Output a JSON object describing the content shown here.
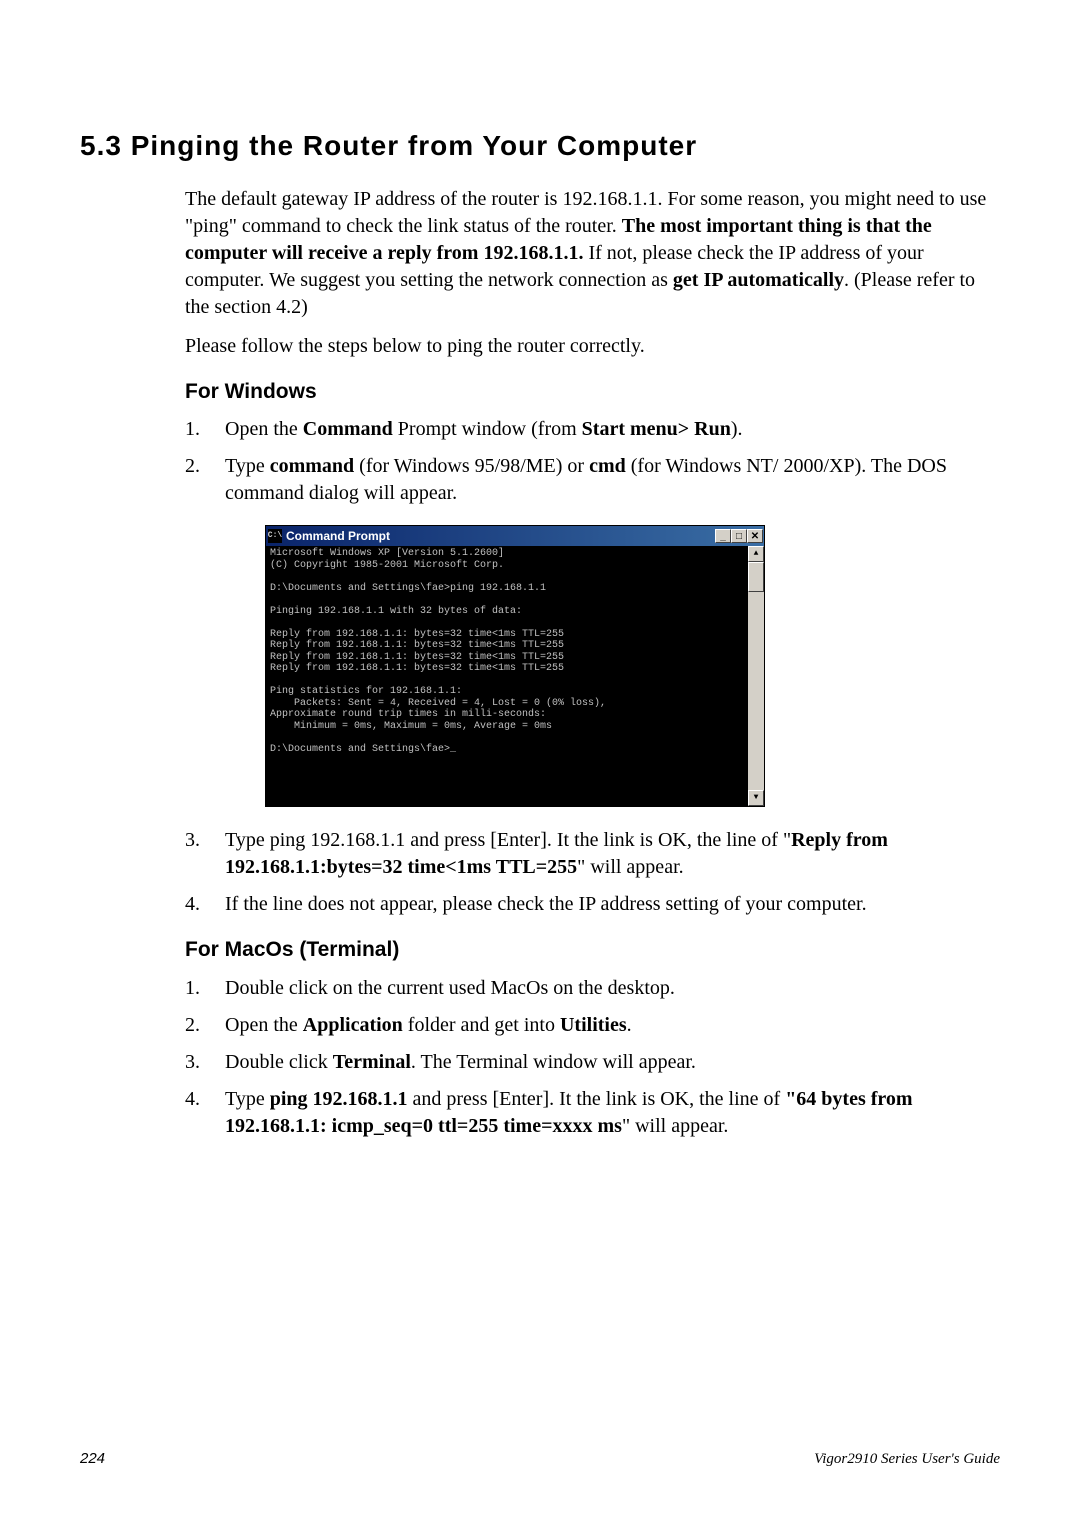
{
  "section": {
    "title": "5.3 Pinging the Router from Your Computer"
  },
  "intro": {
    "p1_a": "The default gateway IP address of the router is 192.168.1.1. For some reason, you might need to use \"ping\" command to check the link status of the router. ",
    "p1_b": "The most important thing is that the computer will receive a reply from 192.168.1.1.",
    "p1_c": " If not, please check the IP address of your computer. We suggest you setting the network connection as ",
    "p1_d": "get IP automatically",
    "p1_e": ". (Please refer to the section 4.2)",
    "p2": "Please follow the steps below to ping the router correctly."
  },
  "windows": {
    "heading": "For Windows",
    "li1_a": "Open the ",
    "li1_b": "Command",
    "li1_c": " Prompt window (from ",
    "li1_d": "Start menu> Run",
    "li1_e": ").",
    "li2_a": "Type ",
    "li2_b": "command",
    "li2_c": " (for Windows 95/98/ME) or ",
    "li2_d": "cmd",
    "li2_e": " (for Windows NT/ 2000/XP). The DOS command dialog will appear.",
    "li3_a": "Type ping 192.168.1.1 and press [Enter]. It the link is OK, the line of \"",
    "li3_b": "Reply from 192.168.1.1:bytes=32 time<1ms TTL=255",
    "li3_c": "\" will appear.",
    "li4": "If the line does not appear, please check the IP address setting of your computer."
  },
  "cmd": {
    "title": "Command Prompt",
    "icon_text": "C:\\",
    "min": "_",
    "max": "□",
    "close": "✕",
    "up": "▲",
    "down": "▼",
    "body": "Microsoft Windows XP [Version 5.1.2600]\n(C) Copyright 1985-2001 Microsoft Corp.\n\nD:\\Documents and Settings\\fae>ping 192.168.1.1\n\nPinging 192.168.1.1 with 32 bytes of data:\n\nReply from 192.168.1.1: bytes=32 time<1ms TTL=255\nReply from 192.168.1.1: bytes=32 time<1ms TTL=255\nReply from 192.168.1.1: bytes=32 time<1ms TTL=255\nReply from 192.168.1.1: bytes=32 time<1ms TTL=255\n\nPing statistics for 192.168.1.1:\n    Packets: Sent = 4, Received = 4, Lost = 0 (0% loss),\nApproximate round trip times in milli-seconds:\n    Minimum = 0ms, Maximum = 0ms, Average = 0ms\n\nD:\\Documents and Settings\\fae>_"
  },
  "macos": {
    "heading": "For MacOs (Terminal)",
    "li1": "Double click on the current used MacOs on the desktop.",
    "li2_a": "Open the ",
    "li2_b": "Application",
    "li2_c": " folder and get into ",
    "li2_d": "Utilities",
    "li2_e": ".",
    "li3_a": "Double click ",
    "li3_b": "Terminal",
    "li3_c": ". The Terminal window will appear.",
    "li4_a": "Type ",
    "li4_b": "ping 192.168.1.1",
    "li4_c": " and press [Enter]. It the link is OK, the line of ",
    "li4_d": "\"64 bytes from 192.168.1.1: icmp_seq=0 ttl=255 time=xxxx ms",
    "li4_e": "\" will appear."
  },
  "footer": {
    "page": "224",
    "guide": "Vigor2910 Series User's Guide"
  }
}
